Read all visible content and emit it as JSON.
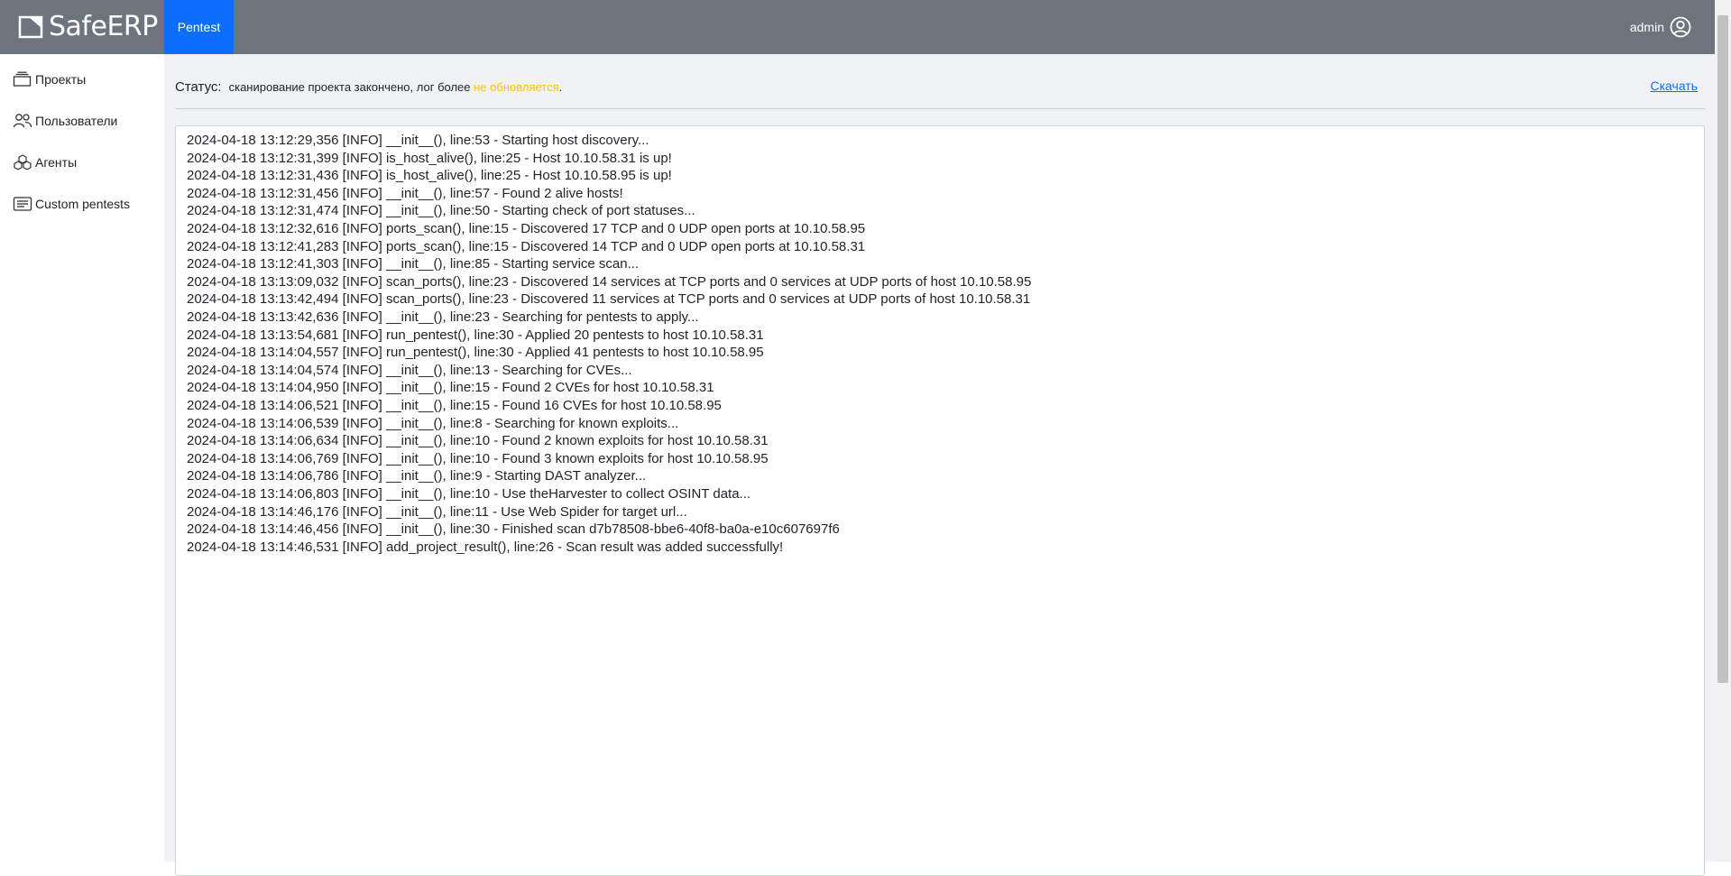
{
  "header": {
    "logo_text": "SafeERP",
    "nav_tab_label": "Pentest",
    "user_name": "admin"
  },
  "sidebar": {
    "items": [
      {
        "label": "Проекты",
        "icon": "projects-icon"
      },
      {
        "label": "Пользователи",
        "icon": "users-icon"
      },
      {
        "label": "Агенты",
        "icon": "agents-icon"
      },
      {
        "label": "Custom pentests",
        "icon": "custom-pentests-icon"
      }
    ]
  },
  "status": {
    "label": "Статус:",
    "text": "сканирование проекта закончено, лог более ",
    "highlight": "не обновляется",
    "suffix": ".",
    "download_label": "Скачать"
  },
  "log": {
    "lines": [
      "2024-04-18 13:12:29,356 [INFO] __init__(), line:53 - Starting host discovery...",
      "2024-04-18 13:12:31,399 [INFO] is_host_alive(), line:25 - Host 10.10.58.31 is up!",
      "2024-04-18 13:12:31,436 [INFO] is_host_alive(), line:25 - Host 10.10.58.95 is up!",
      "2024-04-18 13:12:31,456 [INFO] __init__(), line:57 - Found 2 alive hosts!",
      "2024-04-18 13:12:31,474 [INFO] __init__(), line:50 - Starting check of port statuses...",
      "2024-04-18 13:12:32,616 [INFO] ports_scan(), line:15 - Discovered 17 TCP and 0 UDP open ports at 10.10.58.95",
      "2024-04-18 13:12:41,283 [INFO] ports_scan(), line:15 - Discovered 14 TCP and 0 UDP open ports at 10.10.58.31",
      "2024-04-18 13:12:41,303 [INFO] __init__(), line:85 - Starting service scan...",
      "2024-04-18 13:13:09,032 [INFO] scan_ports(), line:23 - Discovered 14 services at TCP ports and 0 services at UDP ports of host 10.10.58.95",
      "2024-04-18 13:13:42,494 [INFO] scan_ports(), line:23 - Discovered 11 services at TCP ports and 0 services at UDP ports of host 10.10.58.31",
      "2024-04-18 13:13:42,636 [INFO] __init__(), line:23 - Searching for pentests to apply...",
      "2024-04-18 13:13:54,681 [INFO] run_pentest(), line:30 - Applied 20 pentests to host 10.10.58.31",
      "2024-04-18 13:14:04,557 [INFO] run_pentest(), line:30 - Applied 41 pentests to host 10.10.58.95",
      "2024-04-18 13:14:04,574 [INFO] __init__(), line:13 - Searching for CVEs...",
      "2024-04-18 13:14:04,950 [INFO] __init__(), line:15 - Found 2 CVEs for host 10.10.58.31",
      "2024-04-18 13:14:06,521 [INFO] __init__(), line:15 - Found 16 CVEs for host 10.10.58.95",
      "2024-04-18 13:14:06,539 [INFO] __init__(), line:8 - Searching for known exploits...",
      "2024-04-18 13:14:06,634 [INFO] __init__(), line:10 - Found 2 known exploits for host 10.10.58.31",
      "2024-04-18 13:14:06,769 [INFO] __init__(), line:10 - Found 3 known exploits for host 10.10.58.95",
      "2024-04-18 13:14:06,786 [INFO] __init__(), line:9 - Starting DAST analyzer...",
      "2024-04-18 13:14:06,803 [INFO] __init__(), line:10 - Use theHarvester to collect OSINT data...",
      "2024-04-18 13:14:46,176 [INFO] __init__(), line:11 - Use Web Spider for target url...",
      "2024-04-18 13:14:46,456 [INFO] __init__(), line:30 - Finished scan d7b78508-bbe6-40f8-ba0a-e10c607697f6",
      "2024-04-18 13:14:46,531 [INFO] add_project_result(), line:26 - Scan result was added successfully!"
    ]
  },
  "colors": {
    "header_bg": "#6c757d",
    "active_tab_bg": "#0d6efd",
    "status_highlight": "#ffc107",
    "link": "#0d6efd",
    "main_bg": "#f0f2f5"
  }
}
